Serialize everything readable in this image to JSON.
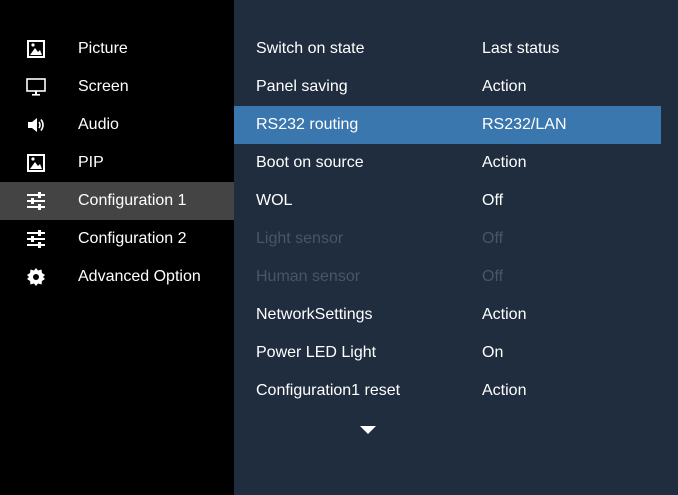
{
  "sidebar": {
    "items": [
      {
        "label": "Picture",
        "icon": "picture-icon",
        "selected": false
      },
      {
        "label": "Screen",
        "icon": "monitor-icon",
        "selected": false
      },
      {
        "label": "Audio",
        "icon": "speaker-icon",
        "selected": false
      },
      {
        "label": "PIP",
        "icon": "pip-icon",
        "selected": false
      },
      {
        "label": "Configuration 1",
        "icon": "sliders-icon",
        "selected": true
      },
      {
        "label": "Configuration 2",
        "icon": "sliders-icon",
        "selected": false
      },
      {
        "label": "Advanced Option",
        "icon": "gear-icon",
        "selected": false
      }
    ]
  },
  "settings": {
    "rows": [
      {
        "label": "Switch on state",
        "value": "Last status",
        "state": "normal"
      },
      {
        "label": "Panel saving",
        "value": "Action",
        "state": "normal"
      },
      {
        "label": "RS232 routing",
        "value": "RS232/LAN",
        "state": "highlighted"
      },
      {
        "label": "Boot on source",
        "value": "Action",
        "state": "normal"
      },
      {
        "label": "WOL",
        "value": "Off",
        "state": "normal"
      },
      {
        "label": "Light sensor",
        "value": "Off",
        "state": "disabled"
      },
      {
        "label": "Human sensor",
        "value": "Off",
        "state": "disabled"
      },
      {
        "label": "NetworkSettings",
        "value": "Action",
        "state": "normal"
      },
      {
        "label": "Power LED Light",
        "value": "On",
        "state": "normal"
      },
      {
        "label": "Configuration1 reset",
        "value": "Action",
        "state": "normal"
      }
    ],
    "more_indicator": "chevron-down-icon"
  },
  "colors": {
    "sidebar_bg": "#000000",
    "sidebar_selected": "#444444",
    "panel_bg": "#1f2d3e",
    "highlight": "#3a77ae",
    "disabled_text": "#4b5563",
    "text": "#ffffff"
  }
}
